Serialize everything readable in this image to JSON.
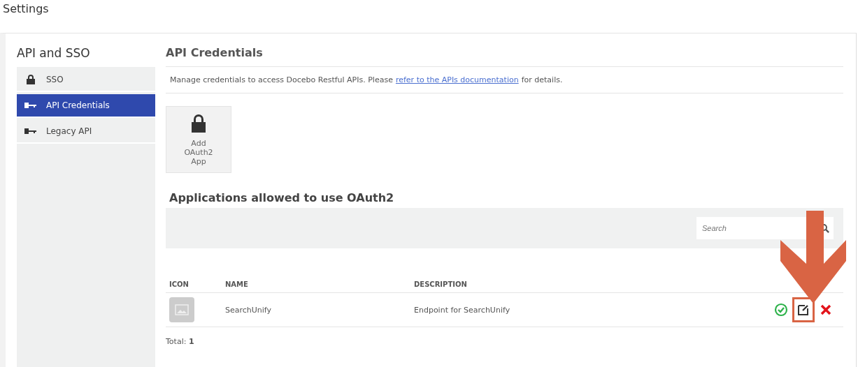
{
  "page_title": "Settings",
  "sidebar": {
    "title": "API and SSO",
    "items": [
      {
        "label": "SSO",
        "kind": "lock",
        "selected": false
      },
      {
        "label": "API Credentials",
        "kind": "key",
        "selected": true
      },
      {
        "label": "Legacy API",
        "kind": "key",
        "selected": false
      }
    ]
  },
  "main": {
    "title": "API Credentials",
    "intro": "Manage credentials to access Docebo Restful APIs. Please",
    "intro_link": "refer to the APIs documentation",
    "intro_end": "for details.",
    "add_tile": "Add OAuth2 App",
    "apps_title": "Applications allowed to use OAuth2",
    "search": {
      "placeholder": "Search"
    },
    "table": {
      "columns": [
        "ICON",
        "NAME",
        "DESCRIPTION"
      ],
      "rows": [
        {
          "name": "SearchUnify",
          "description": "Endpoint for SearchUnify",
          "active": true,
          "edit_highlighted": true
        }
      ]
    },
    "total_label": "Total:",
    "total_value": "1"
  }
}
